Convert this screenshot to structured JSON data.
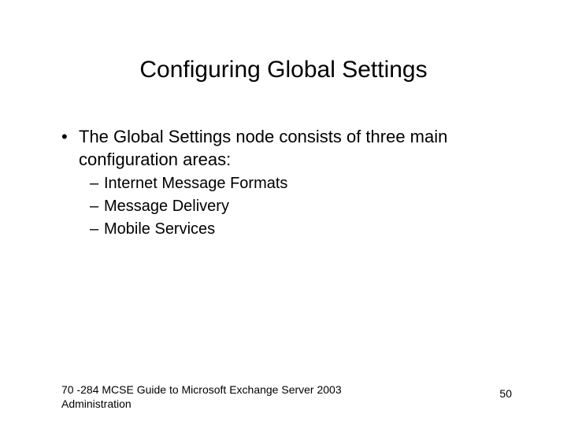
{
  "title": "Configuring Global Settings",
  "bullets": [
    {
      "text": "The Global Settings node consists of three main configuration areas:",
      "sub": [
        "Internet Message Formats",
        "Message Delivery",
        "Mobile Services"
      ]
    }
  ],
  "footer": {
    "left": "70 -284 MCSE Guide to Microsoft Exchange Server 2003 Administration",
    "page": "50"
  }
}
